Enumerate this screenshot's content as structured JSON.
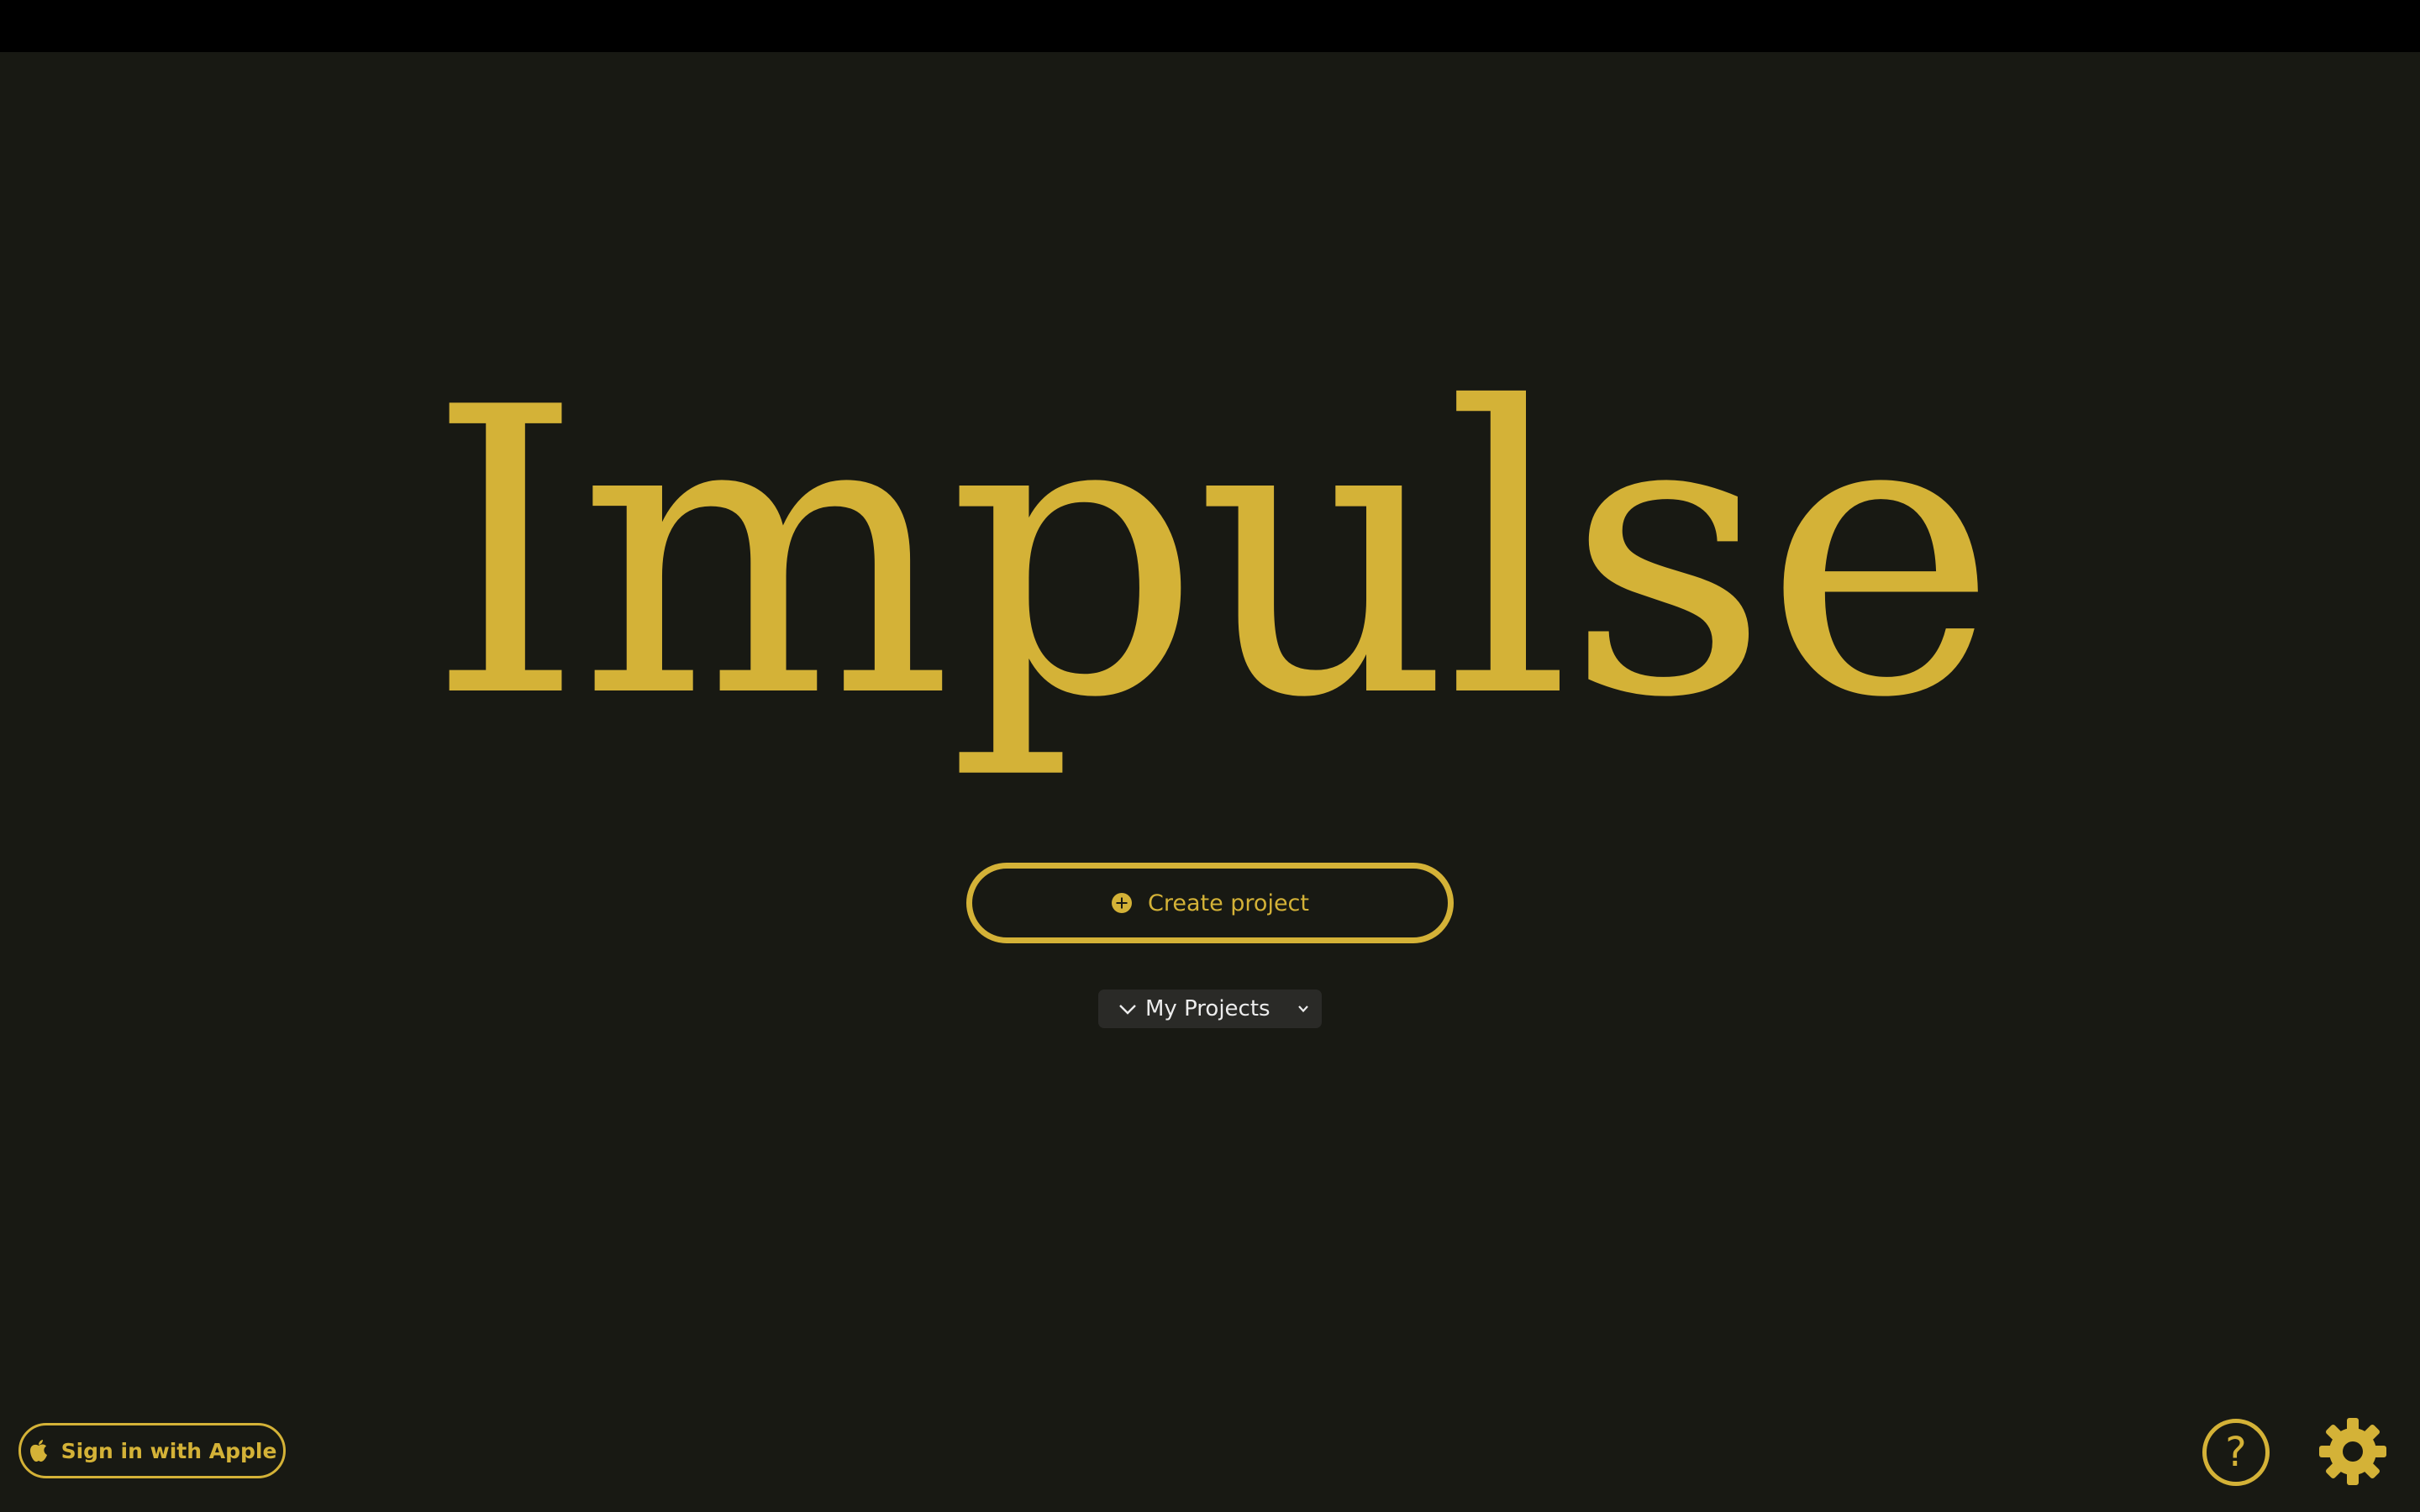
{
  "app": {
    "title": "Impulse"
  },
  "actions": {
    "create_label": "Create project",
    "create_icon": "plus-circle-icon"
  },
  "projects_filter": {
    "selected": "My Projects"
  },
  "footer": {
    "signin_label": "Sign in with Apple",
    "signin_icon": "apple-logo-icon",
    "help_glyph": "?",
    "help_icon": "question-circle-icon",
    "settings_icon": "gear-icon"
  },
  "colors": {
    "background": "#181913",
    "topbar": "#000000",
    "accent": "#d4b237",
    "select_bg": "#2a2a27",
    "select_text": "#ececec"
  }
}
